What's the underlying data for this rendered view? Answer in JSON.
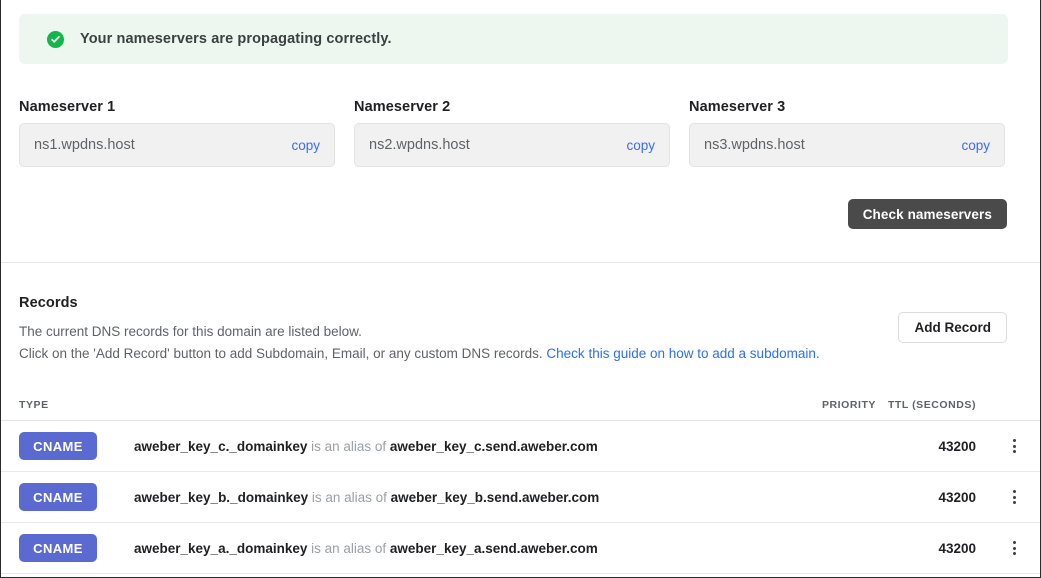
{
  "alert": {
    "icon": "check-circle-icon",
    "message": "Your nameservers are propagating correctly.",
    "bg_color": "#edf7ef",
    "icon_color": "#12b64a"
  },
  "nameservers": {
    "copy_label": "copy",
    "items": [
      {
        "label": "Nameserver 1",
        "value": "ns1.wpdns.host"
      },
      {
        "label": "Nameserver 2",
        "value": "ns2.wpdns.host"
      },
      {
        "label": "Nameserver 3",
        "value": "ns3.wpdns.host"
      }
    ],
    "check_button": "Check nameservers",
    "check_button_color": "#4a4a4a",
    "copy_link_color": "#3b6ef0"
  },
  "records": {
    "title": "Records",
    "description_line1": "The current DNS records for this domain are listed below.",
    "description_line2_prefix": "Click on the 'Add Record' button to add Subdomain, Email, or any custom DNS records. ",
    "guide_link": "Check this guide on how to add a subdomain",
    "description_line2_suffix": ".",
    "guide_link_color": "#2f6fed",
    "add_record_button": "Add Record",
    "columns": {
      "type": "TYPE",
      "description": "",
      "priority": "PRIORITY",
      "ttl": "TTL (SECONDS)",
      "menu": ""
    },
    "badge_color": "#5a6ad0",
    "menu_icon": "kebab-menu-icon",
    "rows": [
      {
        "type": "CNAME",
        "host": "aweber_key_c._domainkey",
        "relation": " is an alias of ",
        "target": "aweber_key_c.send.aweber.com",
        "priority": "",
        "ttl": "43200"
      },
      {
        "type": "CNAME",
        "host": "aweber_key_b._domainkey",
        "relation": " is an alias of ",
        "target": "aweber_key_b.send.aweber.com",
        "priority": "",
        "ttl": "43200"
      },
      {
        "type": "CNAME",
        "host": "aweber_key_a._domainkey",
        "relation": " is an alias of ",
        "target": "aweber_key_a.send.aweber.com",
        "priority": "",
        "ttl": "43200"
      }
    ]
  }
}
